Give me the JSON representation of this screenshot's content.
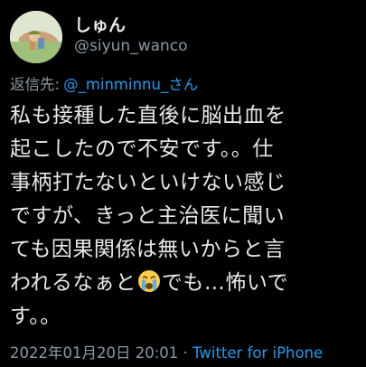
{
  "tweet": {
    "display_name": "しゅん",
    "handle": "@siyun_wanco",
    "reply_prefix": "返信先:",
    "reply_mention": "@_minminnu_さん",
    "body_lines": [
      "私も接種した直後に脳出血を",
      "起こしたので不安です。。仕",
      "事柄打たないといけない感じ",
      "ですが、きっと主治医に聞い",
      "ても因果関係は無いからと言",
      "われるなぁと",
      "でも…怖いで",
      "す。。"
    ],
    "emoji_name": "loudly-crying-face-emoji",
    "timestamp": "2022年01月20日 20:01",
    "separator": " · ",
    "source": "Twitter for iPhone"
  },
  "colors": {
    "background": "#000000",
    "text": "#e7e9ea",
    "secondary": "#8b98a5",
    "link": "#1d9bf0"
  }
}
